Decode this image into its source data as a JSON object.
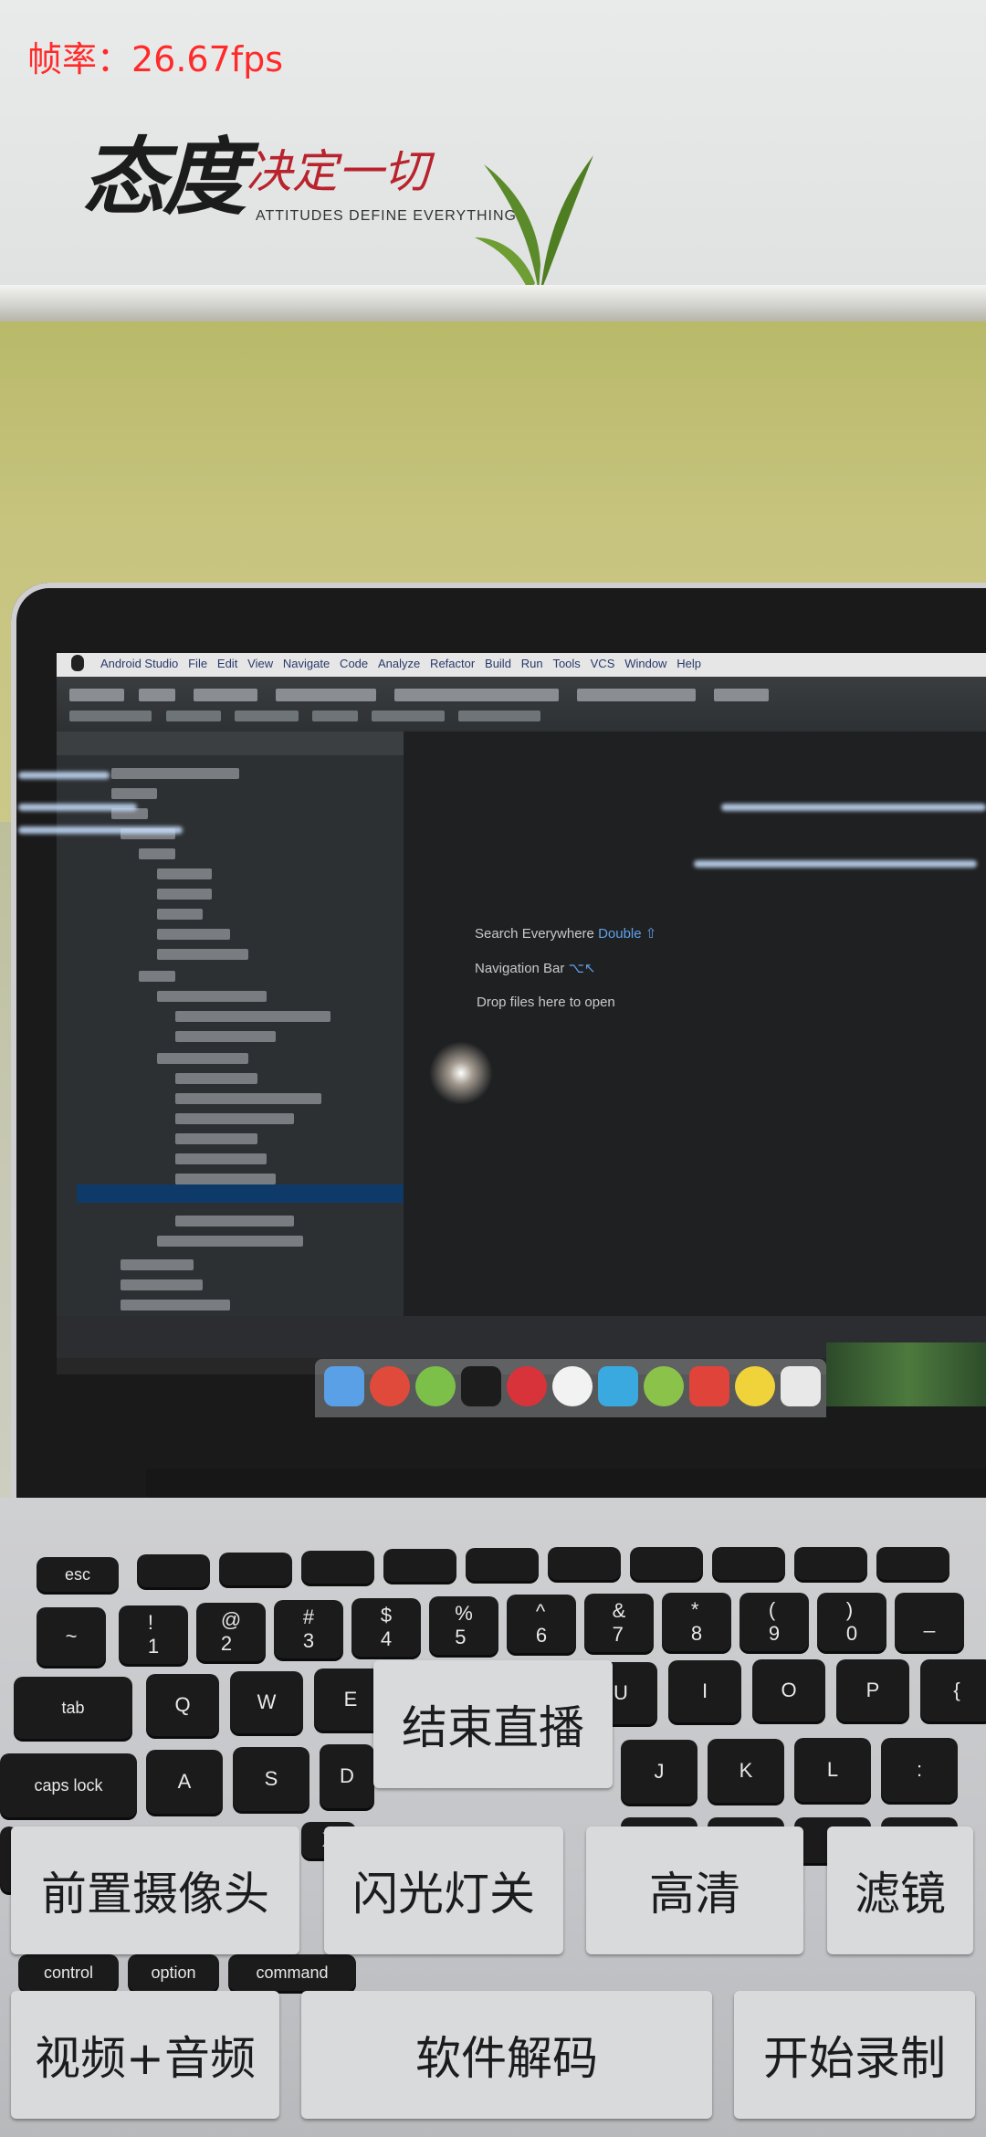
{
  "overlay": {
    "fps_text": "帧率：26.67fps"
  },
  "buttons": {
    "stop_live": "结束直播",
    "front_camera": "前置摄像头",
    "flash_off": "闪光灯关",
    "hd": "高清",
    "filter": "滤镜",
    "video_audio": "视频+音频",
    "software_decode": "软件解码",
    "start_record": "开始录制"
  },
  "scene": {
    "wall_slogan": "态度决定一切",
    "wall_slogan_en": "ATTITUDES DEFINE EVERYTHING",
    "ide_menu": "Android Studio   File   Edit   View   Navigate   Code   Analyze   Refactor   Build   Run   Tools   VCS   Window   Help",
    "ide_hints": [
      "Search Everywhere",
      "Double ⇧",
      "Navigation Bar",
      "⌥↖",
      "Drop files here to open"
    ]
  }
}
